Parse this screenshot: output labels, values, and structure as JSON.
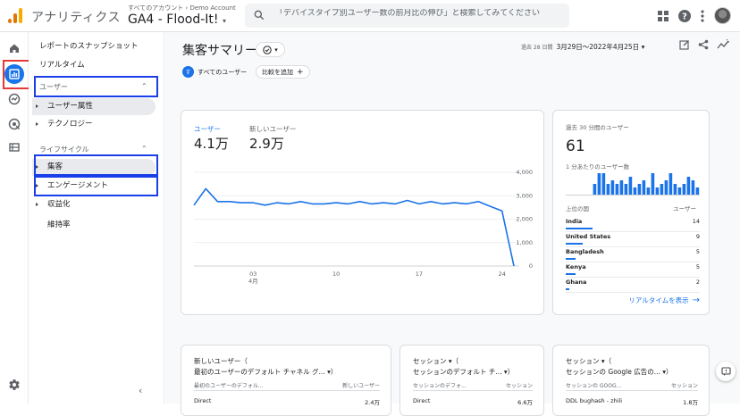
{
  "app": {
    "name": "アナリティクス",
    "crumb": "すべてのアカウント › Demo Account",
    "property": "GA4 - Flood-It!"
  },
  "search": {
    "placeholder": "「デバイスタイプ別ユーザー数の前月比の伸び」と検索してみてください"
  },
  "sidebar": {
    "snapshot": "レポートのスナップショット",
    "realtime": "リアルタイム",
    "user_section": "ユーザー",
    "user_attr": "ユーザー属性",
    "technology": "テクノロジー",
    "lifecycle_section": "ライフサイクル",
    "acquisition": "集客",
    "engagement": "エンゲージメント",
    "monetization": "収益化",
    "retention": "維持率"
  },
  "header": {
    "title": "集客サマリー",
    "date_small": "過去 28 日間",
    "date_range": "3月29日～2022年4月25日",
    "all_users": "すべてのユーザー",
    "all_users_badge": "す",
    "add_compare": "比較を追加"
  },
  "main_card": {
    "metric1_label": "ユーザー",
    "metric1_value": "4.1万",
    "metric2_label": "新しいユーザー",
    "metric2_value": "2.9万"
  },
  "chart_data": {
    "type": "line",
    "x": [
      "3月29日",
      "3月30日",
      "3月31日",
      "4月1日",
      "4月2日",
      "4月3日",
      "4月4日",
      "4月5日",
      "4月6日",
      "4月7日",
      "4月8日",
      "4月9日",
      "4月10日",
      "4月11日",
      "4月12日",
      "4月13日",
      "4月14日",
      "4月15日",
      "4月16日",
      "4月17日",
      "4月18日",
      "4月19日",
      "4月20日",
      "4月21日",
      "4月22日",
      "4月23日",
      "4月24日",
      "4月25日"
    ],
    "series": [
      {
        "values": [
          2600,
          3300,
          2750,
          2750,
          2700,
          2700,
          2600,
          2700,
          2650,
          2750,
          2650,
          2650,
          2700,
          2650,
          2750,
          2650,
          2700,
          2650,
          2800,
          2650,
          2750,
          2650,
          2700,
          2650,
          2750,
          2550,
          2350,
          0
        ]
      }
    ],
    "xticks": [
      {
        "label": "03",
        "sub": "4月",
        "i": 5
      },
      {
        "label": "10",
        "sub": "",
        "i": 12
      },
      {
        "label": "17",
        "sub": "",
        "i": 19
      },
      {
        "label": "24",
        "sub": "",
        "i": 26
      }
    ],
    "yticks": [
      "4,000",
      "3,000",
      "2,000",
      "1,000",
      "0"
    ],
    "ylim": [
      0,
      4000
    ],
    "color": "#1a73e8"
  },
  "realtime": {
    "label": "過去 30 分間のユーザー",
    "value": "61",
    "per_min": "1 分あたりのユーザー数",
    "col_country": "上位の国",
    "col_users": "ユーザー",
    "minute_bars": [
      0,
      0,
      0,
      0,
      0,
      0,
      2,
      5,
      5,
      2,
      3,
      2,
      3,
      2,
      4,
      1,
      2,
      3,
      1,
      5,
      1,
      2,
      3,
      5,
      2,
      1,
      2,
      4,
      3,
      1
    ],
    "rows": [
      {
        "name": "India",
        "value": "14",
        "ratio": 1.0
      },
      {
        "name": "United States",
        "value": "9",
        "ratio": 0.64
      },
      {
        "name": "Bangladesh",
        "value": "5",
        "ratio": 0.36
      },
      {
        "name": "Kenya",
        "value": "5",
        "ratio": 0.36
      },
      {
        "name": "Ghana",
        "value": "2",
        "ratio": 0.14
      }
    ],
    "link": "リアルタイムを表示"
  },
  "bottom_cards": [
    {
      "title1": "新しいユーザー（",
      "title2": "最初のユーザーのデフォルト チャネル グ...",
      "col1": "最初のユーザーのデフォル...",
      "col2": "新しいユーザー",
      "row1": "Direct",
      "row1v": "2.4万"
    },
    {
      "title1": "セッション ▾（",
      "title2": "セッションのデフォルト チ...",
      "col1": "セッションのデフォ...",
      "col2": "セッション",
      "row1": "Direct",
      "row1v": "6.6万"
    },
    {
      "title1": "セッション ▾（",
      "title2": "セッションの Google 広告の...",
      "col1": "セッションの GOOG...",
      "col2": "セッション",
      "row1": "DDL bughash - zhili",
      "row1v": "1.8万"
    }
  ]
}
